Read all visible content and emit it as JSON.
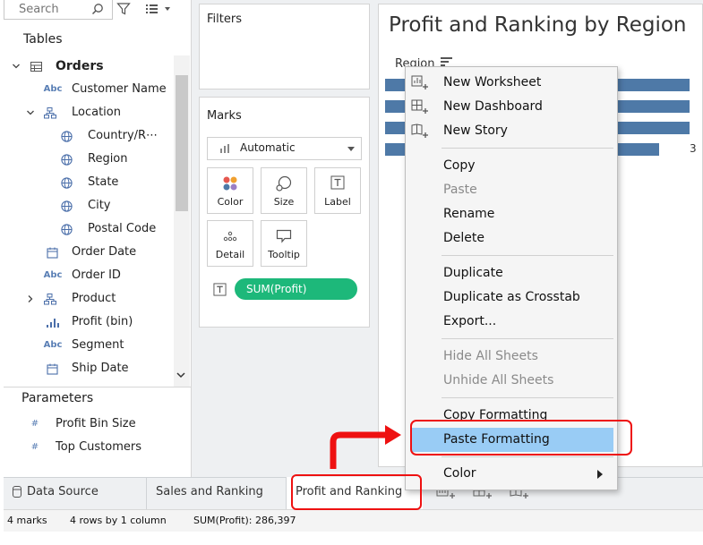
{
  "data_pane": {
    "search_placeholder": "Search",
    "tables_header": "Tables",
    "source_name": "Orders",
    "fields": [
      {
        "type": "Abc",
        "label": "Customer Name"
      },
      {
        "label": "Location"
      },
      {
        "label": "Country/R⋯"
      },
      {
        "label": "Region"
      },
      {
        "label": "State"
      },
      {
        "label": "City"
      },
      {
        "label": "Postal Code"
      },
      {
        "label": "Order Date"
      },
      {
        "type": "Abc",
        "label": "Order ID"
      },
      {
        "label": "Product"
      },
      {
        "label": "Profit (bin)"
      },
      {
        "type": "Abc",
        "label": "Segment"
      },
      {
        "label": "Ship Date"
      }
    ],
    "parameters_header": "Parameters",
    "parameters": [
      {
        "type": "#",
        "label": "Profit Bin Size"
      },
      {
        "type": "#",
        "label": "Top Customers"
      }
    ]
  },
  "shelves": {
    "filters_title": "Filters",
    "marks_title": "Marks",
    "mark_type": "Automatic",
    "buttons": [
      "Color",
      "Size",
      "Label",
      "Detail",
      "Tooltip"
    ],
    "pill": "SUM(Profit)"
  },
  "view": {
    "title": "Profit and Ranking by Region",
    "row_header": "Region",
    "clipped_label": "3",
    "bar_color": "#4e79a7",
    "pill_color": "#1db87a",
    "bar_fraction": [
      1.0,
      1.0,
      1.0,
      0.9
    ]
  },
  "context_menu": {
    "items": [
      {
        "label": "New Worksheet",
        "disabled": false
      },
      {
        "label": "New Dashboard",
        "disabled": false
      },
      {
        "label": "New Story",
        "disabled": false
      },
      {
        "label": "Copy",
        "disabled": false
      },
      {
        "label": "Paste",
        "disabled": true
      },
      {
        "label": "Rename",
        "disabled": false
      },
      {
        "label": "Delete",
        "disabled": false
      },
      {
        "label": "Duplicate",
        "disabled": false
      },
      {
        "label": "Duplicate as Crosstab",
        "disabled": false
      },
      {
        "label": "Export...",
        "disabled": false
      },
      {
        "label": "Hide All Sheets",
        "disabled": true
      },
      {
        "label": "Unhide All Sheets",
        "disabled": true
      },
      {
        "label": "Copy Formatting",
        "disabled": false
      },
      {
        "label": "Paste Formatting",
        "disabled": false,
        "highlighted": true
      },
      {
        "label": "Color",
        "disabled": false,
        "submenu": true
      }
    ],
    "highlight_color": "#99ccf5",
    "annotation_color": "#ee1111"
  },
  "tabs": {
    "data_source": "Data Source",
    "sheets": [
      "Sales and Ranking",
      "Profit and Ranking"
    ],
    "active_sheet": "Profit and Ranking"
  },
  "status": {
    "marks": "4 marks",
    "dims": "4 rows by 1 column",
    "sum": "SUM(Profit): 286,397"
  }
}
